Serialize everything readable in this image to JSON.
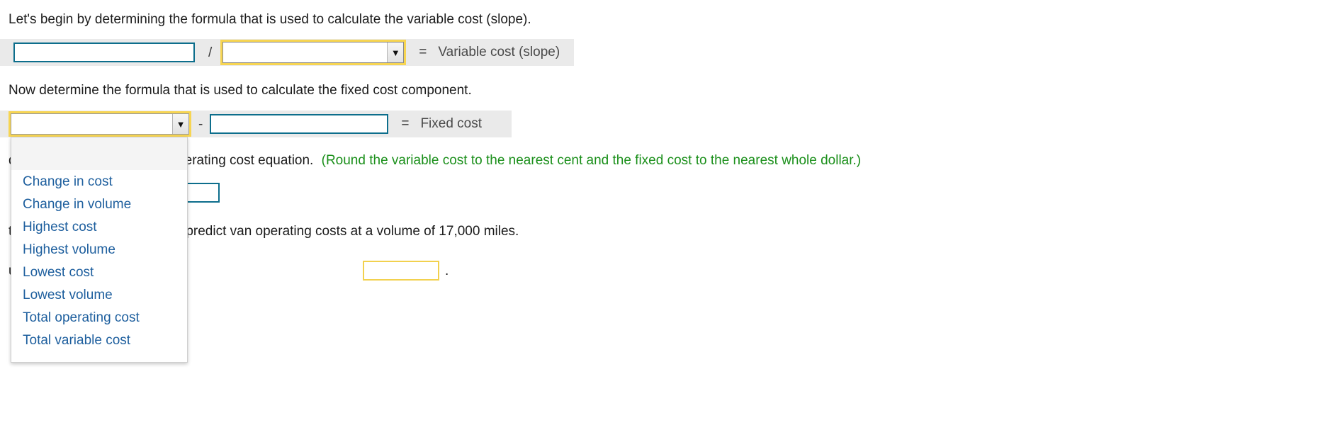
{
  "steps": {
    "step1_text": "Let's begin by determining the formula that is used to calculate the variable cost (slope).",
    "step2_text": "Now determine the formula that is used to calculate the fixed cost component.",
    "step3_text_visible": "determine Flowers 4 You's operating cost equation.",
    "step3_note": "(Round the variable cost to the nearest cent and the fixed cost to the nearest whole dollar.)",
    "step4_text_visible": "tion you determined above to predict van operating costs at a volume of 17,000 miles.",
    "step5_text_visible": "ume of 17,000 miles is $",
    "step5_period": "."
  },
  "formula_row1": {
    "numerator_value": "",
    "numerator_placeholder": "",
    "divide_operator": "/",
    "denominator_value": "",
    "dropdown_arrow": "▼",
    "equals": "=",
    "result_label": "Variable cost (slope)"
  },
  "formula_row2": {
    "minuend_value": "",
    "dropdown_arrow": "▼",
    "minus_operator": "-",
    "subtrahend_value": "",
    "subtrahend_placeholder": "",
    "equals": "=",
    "result_label": "Fixed cost"
  },
  "dropdown_menu": {
    "open": true,
    "items": [
      "Change in cost",
      "Change in volume",
      "Highest cost",
      "Highest volume",
      "Lowest cost",
      "Lowest volume",
      "Total operating cost",
      "Total variable cost"
    ]
  },
  "answer_boxes": {
    "equation_box_value": "",
    "predicted_cost_value": ""
  },
  "colors": {
    "highlight_yellow": "#f7d552",
    "input_blue": "#0d6e8c",
    "menu_link_blue": "#1e5f9e",
    "note_green": "#1a8f1a",
    "strip_grey": "#eaeaea"
  }
}
